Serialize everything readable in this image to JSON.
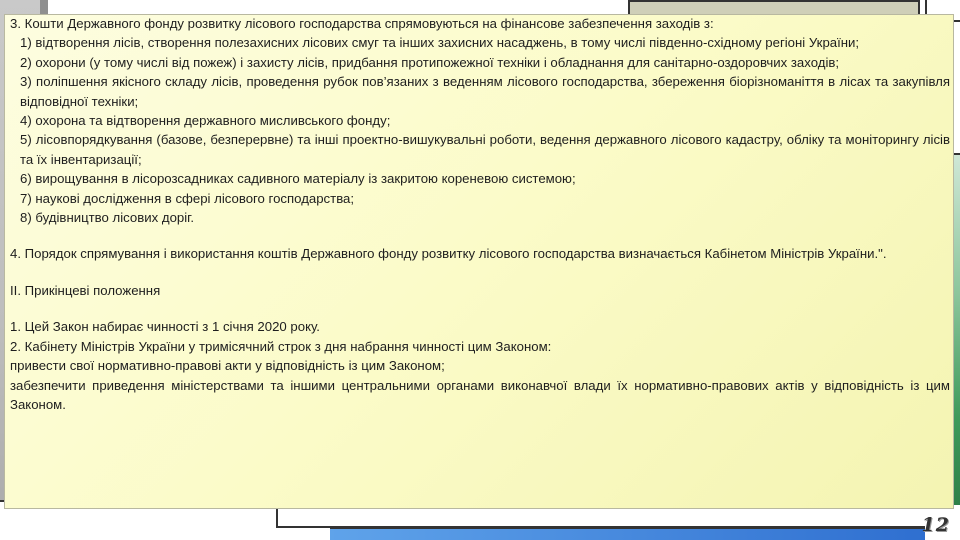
{
  "section3": {
    "intro": "3. Кошти Державного фонду розвитку лісового господарства спрямовуються на фінансове забезпечення заходів з:",
    "items": [
      "1) відтворення лісів, створення полезахисних лісових смуг та інших захисних насаджень, в тому числі південно-східному регіоні України;",
      "2) охорони (у тому числі від пожеж) і захисту лісів, придбання протипожежної техніки і обладнання для санітарно-оздоровчих заходів;",
      "3) поліпшення якісного складу лісів, проведення рубок пов’язаних з веденням лісового господарства, збереження біорізноманіття в лісах та закупівля відповідної техніки;",
      "4) охорона та відтворення державного мисливського фонду;",
      "5) лісовпорядкування (базове, безперервне) та інші проектно-вишукувальні роботи, ведення державного лісового кадастру, обліку та моніторингу лісів та їх інвентаризації;",
      "6) вирощування в лісорозсадниках садивного матеріалу із закритою кореневою системою;",
      "7) наукові дослідження в сфері лісового господарства;",
      "8) будівництво лісових доріг."
    ]
  },
  "section4": "4. Порядок спрямування і використання коштів  Державного фонду розвитку лісового господарства  визначається Кабінетом Міністрів України.\".",
  "final_heading": "ІІ. Прикінцеві положення",
  "final_items": [
    "1. Цей Закон набирає чинності з 1 січня 2020 року.",
    "2. Кабінету Міністрів України у тримісячний строк з дня набрання чинності цим Законом:",
    "привести свої нормативно-правові акти у відповідність із цим Законом;",
    "забезпечити приведення міністерствами та іншими центральними органами виконавчої влади їх нормативно-правових актів у відповідність із цим Законом."
  ],
  "page_number": "12"
}
